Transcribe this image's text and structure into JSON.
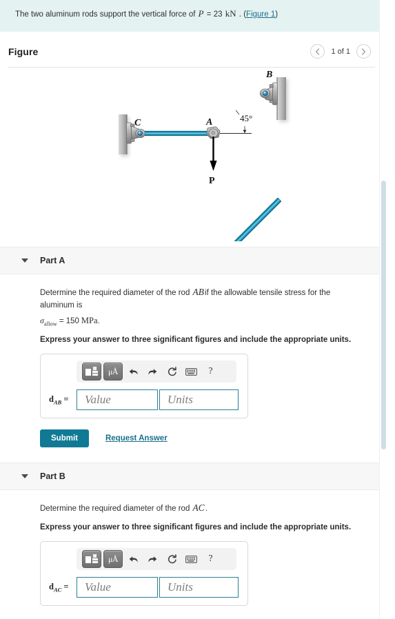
{
  "statement": {
    "text_before": "The two aluminum rods support the vertical force of",
    "var_p": "P",
    "equals_value": "= 23",
    "unit": "kN",
    "period": ".",
    "link_open": "(",
    "link_text": "Figure 1",
    "link_close": ")"
  },
  "figure": {
    "title": "Figure",
    "prev_icon": "chevron-left-icon",
    "next_icon": "chevron-right-icon",
    "counter": "1 of 1",
    "diagram": {
      "labels": {
        "point_a": "A",
        "point_b": "B",
        "point_c": "C",
        "force": "P",
        "angle": "45°"
      },
      "colors": {
        "rod_edge": "#0d7c9e",
        "rod_highlight": "#5ec8e6",
        "bracket": "#9a9a9a",
        "wall": "#b8b8b8",
        "pin": "#2f8fc4",
        "force_arrow": "#000000"
      }
    }
  },
  "parts": [
    {
      "id": "part-a",
      "caret_icon": "caret-down-icon",
      "title": "Part A",
      "question_before": "Determine the required diameter of the rod",
      "question_var": "AB",
      "question_after": "if the allowable tensile stress for the aluminum is",
      "sigma_symbol": "σ",
      "sigma_sub": "allow",
      "sigma_equals": "= 150",
      "sigma_unit": "MPa",
      "sigma_period": ".",
      "instruction": "Express your answer to three significant figures and include the appropriate units.",
      "toolbar": {
        "template_icon": "math-template-icon",
        "units_icon": "units-micro-angstrom-icon",
        "units_label": "μÅ",
        "undo_icon": "undo-arrow-icon",
        "redo_icon": "redo-arrow-icon",
        "reset_icon": "reset-circular-arrow-icon",
        "keyboard_icon": "keyboard-icon",
        "help_icon": "help-question-icon",
        "help_label": "?"
      },
      "answer": {
        "var_symbol": "d",
        "var_sub": "AB",
        "var_equals": "=",
        "value_placeholder": "Value",
        "units_placeholder": "Units",
        "value_current": "",
        "units_current": ""
      },
      "submit_label": "Submit",
      "request_label": "Request Answer",
      "has_submit": true
    },
    {
      "id": "part-b",
      "caret_icon": "caret-down-icon",
      "title": "Part B",
      "question_before": "Determine the required diameter of the rod",
      "question_var": "AC",
      "question_after": ".",
      "instruction": "Express your answer to three significant figures and include the appropriate units.",
      "toolbar": {
        "template_icon": "math-template-icon",
        "units_icon": "units-micro-angstrom-icon",
        "units_label": "μÅ",
        "undo_icon": "undo-arrow-icon",
        "redo_icon": "redo-arrow-icon",
        "reset_icon": "reset-circular-arrow-icon",
        "keyboard_icon": "keyboard-icon",
        "help_icon": "help-question-icon",
        "help_label": "?"
      },
      "answer": {
        "var_symbol": "d",
        "var_sub": "AC",
        "var_equals": "=",
        "value_placeholder": "Value",
        "units_placeholder": "Units",
        "value_current": "",
        "units_current": ""
      },
      "has_submit": false
    }
  ],
  "theme": {
    "banner_bg": "#e4f2f2",
    "accent": "#107a95",
    "link": "#1a6f8c",
    "field_border": "#2a7f93",
    "section_bg": "#f7f7f7"
  }
}
